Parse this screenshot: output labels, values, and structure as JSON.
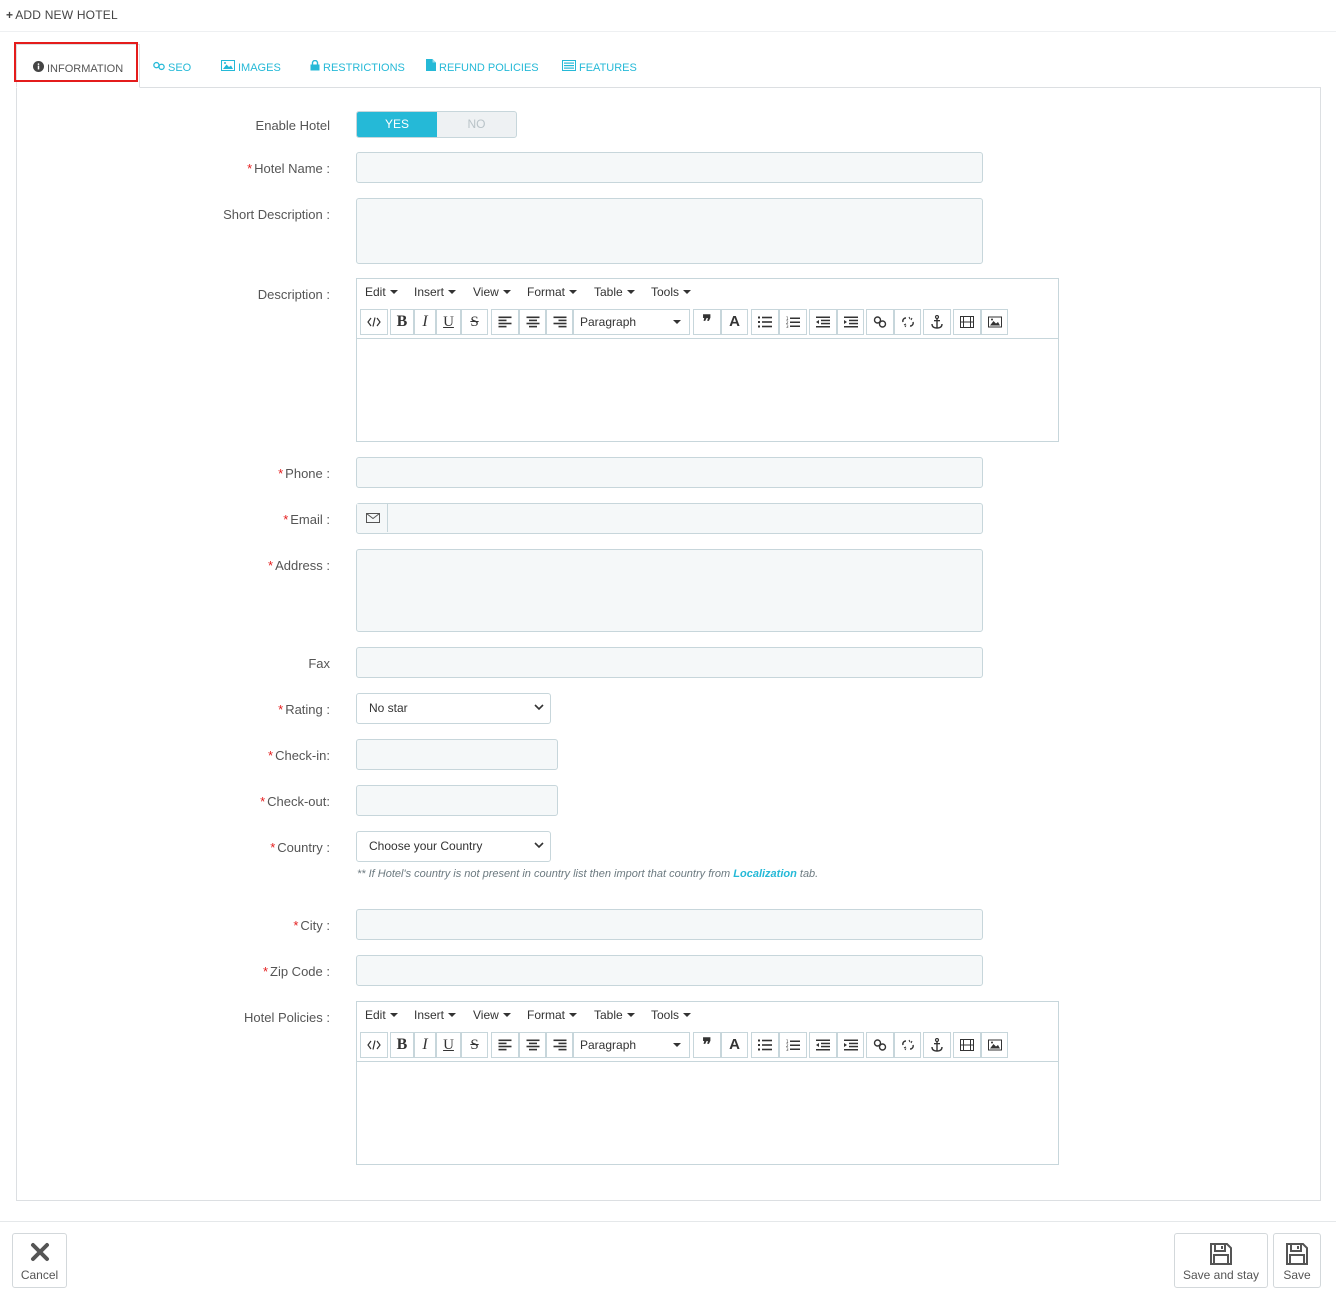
{
  "header": {
    "plus": "+",
    "title": "ADD NEW HOTEL"
  },
  "tabs": [
    {
      "label": "INFORMATION",
      "icon": "info-circle-icon"
    },
    {
      "label": "SEO",
      "icon": "link-icon"
    },
    {
      "label": "IMAGES",
      "icon": "image-icon"
    },
    {
      "label": "RESTRICTIONS",
      "icon": "lock-icon"
    },
    {
      "label": "REFUND POLICIES",
      "icon": "file-icon"
    },
    {
      "label": "FEATURES",
      "icon": "list-icon"
    }
  ],
  "form": {
    "enable_hotel": {
      "label": "Enable Hotel",
      "yes": "YES",
      "no": "NO",
      "value": "YES"
    },
    "hotel_name": {
      "required": "*",
      "label": "Hotel Name :"
    },
    "short_description": {
      "label": "Short Description :"
    },
    "description": {
      "label": "Description :"
    },
    "phone": {
      "required": "*",
      "label": "Phone :"
    },
    "email": {
      "required": "*",
      "label": "Email :"
    },
    "address": {
      "required": "*",
      "label": "Address :"
    },
    "fax": {
      "label": "Fax"
    },
    "rating": {
      "required": "*",
      "label": "Rating :",
      "value": "No star"
    },
    "check_in": {
      "required": "*",
      "label": "Check-in:"
    },
    "check_out": {
      "required": "*",
      "label": "Check-out:"
    },
    "country": {
      "required": "*",
      "label": "Country :",
      "value": "Choose your Country",
      "help_prefix": "** If Hotel's country is not present in country list then import that country from ",
      "help_link": "Localization",
      "help_suffix": " tab."
    },
    "city": {
      "required": "*",
      "label": "City :"
    },
    "zip_code": {
      "required": "*",
      "label": "Zip Code :"
    },
    "hotel_policies": {
      "label": "Hotel Policies :"
    }
  },
  "editor": {
    "menu": [
      "Edit",
      "Insert",
      "View",
      "Format",
      "Table",
      "Tools"
    ],
    "paragraph": "Paragraph",
    "bold": "B",
    "italic": "I",
    "underline": "U",
    "strike": "S",
    "quote": "❞",
    "text_color": "A"
  },
  "footer": {
    "cancel": "Cancel",
    "save_and_stay": "Save and stay",
    "save": "Save"
  },
  "colors": {
    "accent": "#25b9d7",
    "required": "#e41c1c",
    "input_bg": "#f5f8f9",
    "border": "#c7d6db"
  }
}
